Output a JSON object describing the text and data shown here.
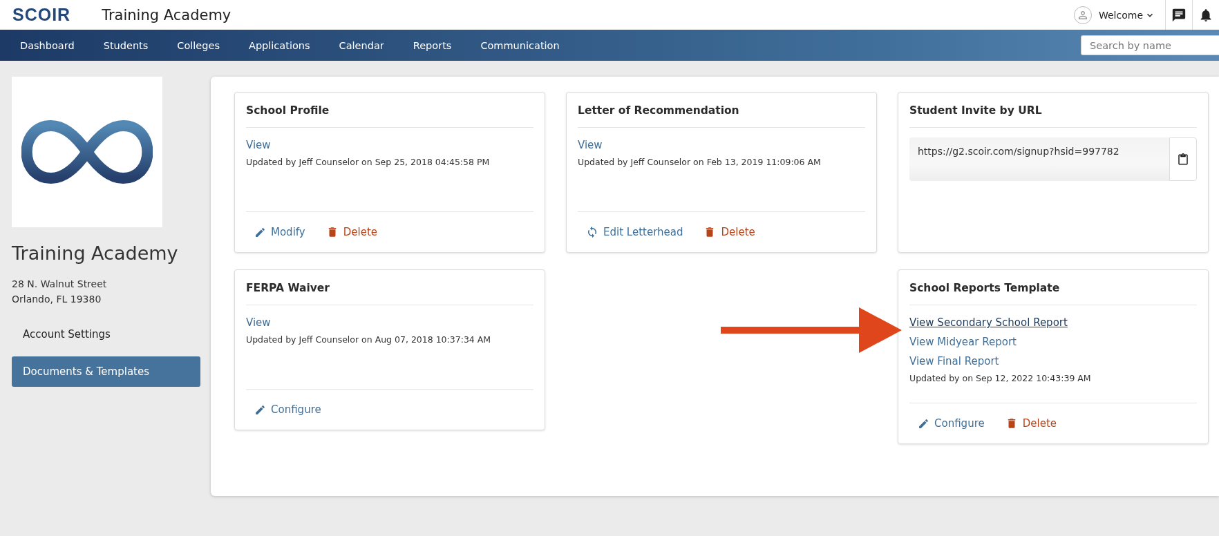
{
  "header": {
    "logo": "SCOIR",
    "title": "Training Academy",
    "user": "Welcome"
  },
  "nav": {
    "items": [
      {
        "label": "Dashboard"
      },
      {
        "label": "Students"
      },
      {
        "label": "Colleges"
      },
      {
        "label": "Applications"
      },
      {
        "label": "Calendar"
      },
      {
        "label": "Reports"
      },
      {
        "label": "Communication"
      }
    ],
    "search": {
      "placeholder": "Search by name"
    }
  },
  "sidebar": {
    "school_name": "Training Academy",
    "address": [
      "28 N. Walnut Street",
      "Orlando, FL 19380"
    ],
    "menu": [
      {
        "label": "Account Settings",
        "selected": false
      },
      {
        "label": "Documents & Templates",
        "selected": true
      }
    ]
  },
  "columns": [
    {
      "cards": [
        {
          "kind": "document",
          "title": "School Profile",
          "links": [
            {
              "label": "View",
              "hovered": false
            }
          ],
          "updated": "Updated by Jeff Counselor on Sep 25, 2018 04:45:58 PM",
          "actions": [
            {
              "kind": "edit",
              "label": "Modify"
            },
            {
              "kind": "delete",
              "label": "Delete"
            }
          ]
        },
        {
          "kind": "document",
          "title": "FERPA Waiver",
          "links": [
            {
              "label": "View",
              "hovered": false
            }
          ],
          "updated": "Updated by Jeff Counselor on Aug 07, 2018 10:37:34 AM",
          "actions": [
            {
              "kind": "edit",
              "label": "Configure"
            }
          ]
        }
      ]
    },
    {
      "cards": [
        {
          "kind": "document",
          "title": "Letter of Recommendation",
          "links": [
            {
              "label": "View",
              "hovered": false
            }
          ],
          "updated": "Updated by Jeff Counselor on Feb 13, 2019 11:09:06 AM",
          "actions": [
            {
              "kind": "refresh",
              "label": "Edit Letterhead"
            },
            {
              "kind": "delete",
              "label": "Delete"
            }
          ]
        }
      ]
    },
    {
      "cards": [
        {
          "kind": "url",
          "title": "Student Invite by URL",
          "url": "https://g2.scoir.com/signup?hsid=997782"
        },
        {
          "kind": "document",
          "title": "School Reports Template",
          "links": [
            {
              "label": "View Secondary School Report",
              "hovered": true
            },
            {
              "label": "View Midyear Report",
              "hovered": false
            },
            {
              "label": "View Final Report",
              "hovered": false
            }
          ],
          "updated": "Updated by on Sep 12, 2022 10:43:39 AM",
          "actions": [
            {
              "kind": "edit",
              "label": "Configure"
            },
            {
              "kind": "delete",
              "label": "Delete"
            }
          ]
        }
      ]
    }
  ],
  "annotation": {
    "kind": "arrow"
  }
}
